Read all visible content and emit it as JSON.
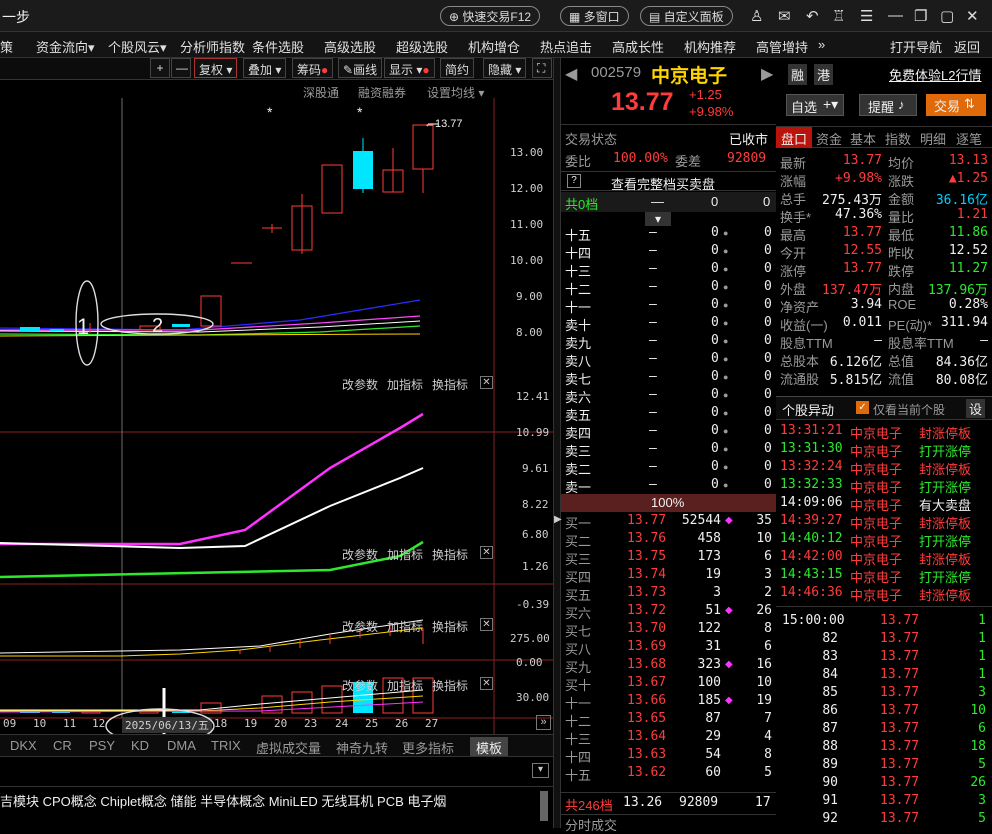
{
  "titlebar": {
    "left_text": "一步",
    "fast_trade": "快速交易F12",
    "multi_window": "多窗口",
    "custom_panel": "自定义面板"
  },
  "menu": {
    "items": [
      "策",
      "资金流向",
      "个股风云",
      "分析师指数",
      "条件选股",
      "高级选股",
      "超级选股",
      "机构增仓",
      "热点追击",
      "高成长性",
      "机构推荐",
      "高管增持"
    ],
    "right": [
      "打开导航",
      "返回"
    ]
  },
  "chart_toolbar": {
    "plus": "+",
    "minus": "—",
    "fuquan": "复权",
    "diejia": "叠加",
    "chouma": "筹码",
    "huaxian": "画线",
    "xianshi": "显示",
    "jianyue": "简约",
    "yincang": "隐藏"
  },
  "main_chart": {
    "links": [
      "深股通",
      "融资融券",
      "设置均线"
    ],
    "price_axis": [
      "13.00",
      "12.00",
      "11.00",
      "10.00",
      "9.00",
      "8.00"
    ],
    "high_label": "13.77",
    "annotations": [
      "1",
      "2"
    ],
    "star": "*"
  },
  "indicators": [
    {
      "controls": [
        "改参数",
        "加指标",
        "换指标"
      ],
      "axis": [
        "12.41",
        "10.99",
        "9.61",
        "8.22",
        "6.80"
      ]
    },
    {
      "controls": [
        "改参数",
        "加指标",
        "换指标"
      ],
      "axis": [
        "1.26",
        "-0.39"
      ]
    },
    {
      "controls": [
        "改参数",
        "加指标",
        "换指标"
      ],
      "axis": [
        "275.00",
        "0.00"
      ]
    },
    {
      "controls": [
        "改参数",
        "加指标",
        "换指标"
      ],
      "axis": [
        "30.00"
      ]
    }
  ],
  "date_axis": {
    "labels": [
      "09",
      "10",
      "11",
      "12",
      "18",
      "19",
      "20",
      "23",
      "24",
      "25",
      "26",
      "27"
    ],
    "selected": "2025/06/13/五"
  },
  "indicator_tabs": [
    "DKX",
    "CR",
    "PSY",
    "KD",
    "DMA",
    "TRIX",
    "虚拟成交量",
    "神奇九转",
    "更多指标",
    "模板"
  ],
  "concepts": "吉模块 CPO概念 Chiplet概念 储能 半导体概念 MiniLED 无线耳机 PCB 电子烟",
  "stock": {
    "code": "002579",
    "name": "中京电子",
    "price": "13.77",
    "change": "+1.25",
    "change_pct": "+9.98%",
    "badges": [
      "融",
      "港"
    ],
    "l2_link": "免费体验L2行情",
    "watchlist": "自选",
    "alert": "提醒",
    "trade": "交易"
  },
  "status": {
    "label": "交易状态",
    "value": "已收市",
    "weibi_label": "委比",
    "weibi": "100.00%",
    "weicha_label": "委差",
    "weicha": "92809",
    "full_book": "查看完整档买卖盘",
    "total_label": "共0档",
    "total_dash": "—",
    "total_v1": "0",
    "total_v2": "0"
  },
  "asks": [
    {
      "label": "十五",
      "price": "—",
      "vol": "0",
      "n": "0"
    },
    {
      "label": "十四",
      "price": "—",
      "vol": "0",
      "n": "0"
    },
    {
      "label": "十三",
      "price": "—",
      "vol": "0",
      "n": "0"
    },
    {
      "label": "十二",
      "price": "—",
      "vol": "0",
      "n": "0"
    },
    {
      "label": "十一",
      "price": "—",
      "vol": "0",
      "n": "0"
    },
    {
      "label": "卖十",
      "price": "—",
      "vol": "0",
      "n": "0"
    },
    {
      "label": "卖九",
      "price": "—",
      "vol": "0",
      "n": "0"
    },
    {
      "label": "卖八",
      "price": "—",
      "vol": "0",
      "n": "0"
    },
    {
      "label": "卖七",
      "price": "—",
      "vol": "0",
      "n": "0"
    },
    {
      "label": "卖六",
      "price": "—",
      "vol": "0",
      "n": "0"
    },
    {
      "label": "卖五",
      "price": "—",
      "vol": "0",
      "n": "0"
    },
    {
      "label": "卖四",
      "price": "—",
      "vol": "0",
      "n": "0"
    },
    {
      "label": "卖三",
      "price": "—",
      "vol": "0",
      "n": "0"
    },
    {
      "label": "卖二",
      "price": "—",
      "vol": "0",
      "n": "0"
    },
    {
      "label": "卖一",
      "price": "—",
      "vol": "0",
      "n": "0"
    }
  ],
  "ratio_bar": "100%",
  "bids": [
    {
      "label": "买一",
      "price": "13.77",
      "vol": "52544",
      "n": "35",
      "dot": true
    },
    {
      "label": "买二",
      "price": "13.76",
      "vol": "458",
      "n": "10"
    },
    {
      "label": "买三",
      "price": "13.75",
      "vol": "173",
      "n": "6"
    },
    {
      "label": "买四",
      "price": "13.74",
      "vol": "19",
      "n": "3"
    },
    {
      "label": "买五",
      "price": "13.73",
      "vol": "3",
      "n": "2"
    },
    {
      "label": "买六",
      "price": "13.72",
      "vol": "51",
      "n": "26",
      "dot": true
    },
    {
      "label": "买七",
      "price": "13.70",
      "vol": "122",
      "n": "8"
    },
    {
      "label": "买八",
      "price": "13.69",
      "vol": "31",
      "n": "6"
    },
    {
      "label": "买九",
      "price": "13.68",
      "vol": "323",
      "n": "16",
      "dot": true
    },
    {
      "label": "买十",
      "price": "13.67",
      "vol": "100",
      "n": "10"
    },
    {
      "label": "十一",
      "price": "13.66",
      "vol": "185",
      "n": "19",
      "dot": true
    },
    {
      "label": "十二",
      "price": "13.65",
      "vol": "87",
      "n": "7"
    },
    {
      "label": "十三",
      "price": "13.64",
      "vol": "29",
      "n": "4"
    },
    {
      "label": "十四",
      "price": "13.63",
      "vol": "54",
      "n": "8"
    },
    {
      "label": "十五",
      "price": "13.62",
      "vol": "60",
      "n": "5"
    }
  ],
  "bid_total": {
    "label": "共246档",
    "price": "13.26",
    "vol": "92809",
    "n": "17"
  },
  "bottom_mid": "分时成交",
  "right_tabs": [
    "盘口",
    "资金",
    "基本",
    "指数",
    "明细",
    "逐笔"
  ],
  "quote": [
    [
      "最新",
      "13.77",
      "red",
      "均价",
      "13.13",
      "red"
    ],
    [
      "涨幅",
      "+9.98%",
      "red",
      "涨跌",
      "▲1.25",
      "red"
    ],
    [
      "总手",
      "275.43万",
      "white",
      "金额",
      "36.16亿",
      "cyan"
    ],
    [
      "换手*",
      "47.36%",
      "white",
      "量比",
      "1.21",
      "red"
    ],
    [
      "最高",
      "13.77",
      "red",
      "最低",
      "11.86",
      "green"
    ],
    [
      "今开",
      "12.55",
      "red",
      "昨收",
      "12.52",
      "white"
    ],
    [
      "涨停",
      "13.77",
      "red",
      "跌停",
      "11.27",
      "green"
    ],
    [
      "外盘",
      "137.47万",
      "red",
      "内盘",
      "137.96万",
      "green"
    ],
    [
      "净资产",
      "3.94",
      "white",
      "ROE",
      "0.28%",
      "white"
    ],
    [
      "收益(一)",
      "0.011",
      "white",
      "PE(动)*",
      "311.94",
      "white"
    ],
    [
      "股息TTM",
      "—",
      "white",
      "股息率TTM",
      "—",
      "white"
    ],
    [
      "总股本",
      "6.126亿",
      "white",
      "总值",
      "84.36亿",
      "white"
    ],
    [
      "流通股",
      "5.815亿",
      "white",
      "流值",
      "80.08亿",
      "white"
    ]
  ],
  "movers": {
    "title": "个股异动",
    "checkbox": "仅看当前个股",
    "settings": "设",
    "rows": [
      [
        "13:31:21",
        "中京电子",
        "封涨停板",
        "red"
      ],
      [
        "13:31:30",
        "中京电子",
        "打开涨停",
        "green"
      ],
      [
        "13:32:24",
        "中京电子",
        "封涨停板",
        "red"
      ],
      [
        "13:32:33",
        "中京电子",
        "打开涨停",
        "green"
      ],
      [
        "14:09:06",
        "中京电子",
        "有大卖盘",
        "white"
      ],
      [
        "14:39:27",
        "中京电子",
        "封涨停板",
        "red"
      ],
      [
        "14:40:12",
        "中京电子",
        "打开涨停",
        "green"
      ],
      [
        "14:42:00",
        "中京电子",
        "封涨停板",
        "red"
      ],
      [
        "14:43:15",
        "中京电子",
        "打开涨停",
        "green"
      ],
      [
        "14:46:36",
        "中京电子",
        "封涨停板",
        "red"
      ]
    ]
  },
  "ticks": [
    [
      "15:00:00",
      "13.77",
      "1"
    ],
    [
      "82",
      "13.77",
      "1"
    ],
    [
      "83",
      "13.77",
      "1"
    ],
    [
      "84",
      "13.77",
      "1"
    ],
    [
      "85",
      "13.77",
      "3"
    ],
    [
      "86",
      "13.77",
      "10"
    ],
    [
      "87",
      "13.77",
      "6"
    ],
    [
      "88",
      "13.77",
      "18"
    ],
    [
      "89",
      "13.77",
      "5"
    ],
    [
      "90",
      "13.77",
      "26"
    ],
    [
      "91",
      "13.77",
      "3"
    ],
    [
      "92",
      "13.77",
      "5"
    ]
  ]
}
